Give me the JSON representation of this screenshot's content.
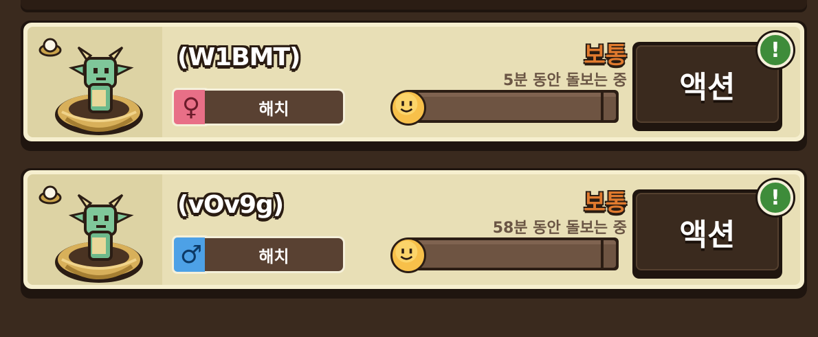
{
  "cards": [
    {
      "pet_name": "(W1BMT)",
      "gender": "female",
      "gender_symbol": "♀",
      "stage": "해치",
      "mood": "보통",
      "care_time": "5분 동안 돌보는 중",
      "progress": 0.04,
      "action_label": "액션",
      "alert": "!"
    },
    {
      "pet_name": "(vOv9g)",
      "gender": "male",
      "gender_symbol": "♂",
      "stage": "해치",
      "mood": "보통",
      "care_time": "58분 동안 돌보는 중",
      "progress": 0.04,
      "action_label": "액션",
      "alert": "!"
    }
  ],
  "colors": {
    "mood": "#e07a2e",
    "female": "#e86f87",
    "male": "#4da1e6",
    "alert": "#3e8c3a",
    "card_bg": "#f6efcf",
    "frame": "#3a2a1e"
  }
}
